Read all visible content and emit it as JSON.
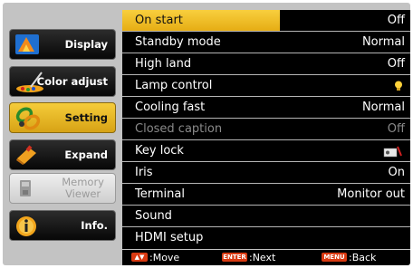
{
  "sidebar": {
    "items": [
      {
        "label": "Display",
        "icon": "display-icon"
      },
      {
        "label": "Color adjust",
        "icon": "color-adjust-icon"
      },
      {
        "label": "Setting",
        "icon": "setting-icon",
        "active": true
      },
      {
        "label": "Expand",
        "icon": "expand-icon"
      },
      {
        "label": "Memory",
        "label2": "Viewer",
        "icon": "memory-viewer-icon",
        "disabled": true
      },
      {
        "label": "Info.",
        "icon": "info-icon"
      }
    ]
  },
  "menu": {
    "rows": [
      {
        "label": "On start",
        "value": "Off",
        "selected": true
      },
      {
        "label": "Standby mode",
        "value": "Normal"
      },
      {
        "label": "High land",
        "value": "Off"
      },
      {
        "label": "Lamp control",
        "value": "",
        "icon": "lamp-bulb-icon"
      },
      {
        "label": "Cooling fast",
        "value": "Normal"
      },
      {
        "label": "Closed caption",
        "value": "Off",
        "disabled": true
      },
      {
        "label": "Key lock",
        "value": "",
        "icon": "key-lock-icon"
      },
      {
        "label": "Iris",
        "value": "On"
      },
      {
        "label": "Terminal",
        "value": "Monitor out"
      },
      {
        "label": "Sound",
        "value": ""
      },
      {
        "label": "HDMI setup",
        "value": ""
      }
    ]
  },
  "footer": {
    "move_key": "▲▼",
    "move_label": ":Move",
    "enter_key": "ENTER",
    "enter_label": ":Next",
    "menu_key": "MENU",
    "menu_label": ":Back"
  },
  "colors": {
    "accent": "#f2c12e",
    "key_button": "#d93a12"
  }
}
